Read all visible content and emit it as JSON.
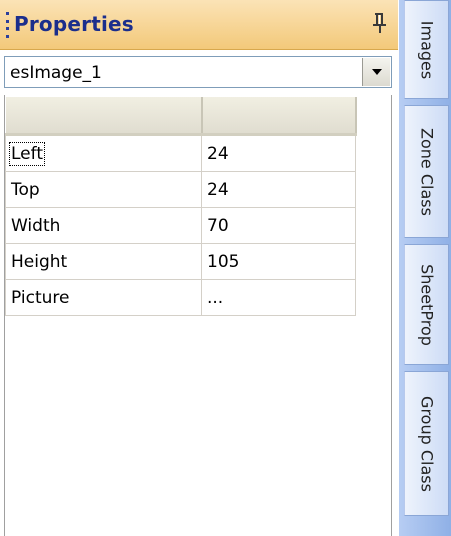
{
  "panel": {
    "title": "Properties",
    "selected_object": "esImage_1"
  },
  "grid": {
    "header": [
      "",
      ""
    ],
    "rows": [
      {
        "name": "Left",
        "value": "24"
      },
      {
        "name": "Top",
        "value": "24"
      },
      {
        "name": "Width",
        "value": "70"
      },
      {
        "name": "Height",
        "value": "105"
      },
      {
        "name": "Picture",
        "value": "..."
      }
    ]
  },
  "side_tabs": [
    "Images",
    "Zone Class",
    "SheetProp",
    "Group Class"
  ],
  "icons": {
    "pin": "pushpin-icon",
    "dropdown": "dropdown-arrow-icon",
    "grip": "grip-icon"
  },
  "colors": {
    "title_text": "#1b2e8c",
    "titlebar": "#f3c97a",
    "sidebar": "#8fb0e6"
  }
}
